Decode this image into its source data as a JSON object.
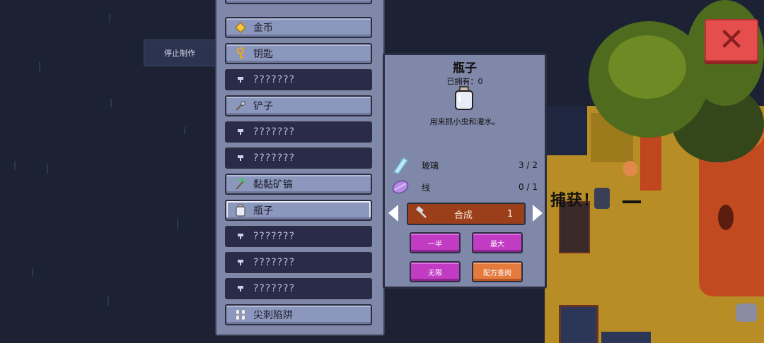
{
  "stop_button": {
    "label": "停止制作"
  },
  "recipe_list": [
    {
      "label": "金币",
      "state": "known",
      "icon": "gold-coin-icon"
    },
    {
      "label": "钥匙",
      "state": "known",
      "icon": "key-icon"
    },
    {
      "label": "???????",
      "state": "unknown",
      "icon": "locked-icon"
    },
    {
      "label": "铲子",
      "state": "known",
      "icon": "shovel-icon"
    },
    {
      "label": "???????",
      "state": "unknown",
      "icon": "locked-icon"
    },
    {
      "label": "???????",
      "state": "unknown",
      "icon": "locked-icon"
    },
    {
      "label": "黏黏矿镐",
      "state": "known",
      "icon": "pickaxe-icon"
    },
    {
      "label": "瓶子",
      "state": "selected",
      "icon": "bottle-icon"
    },
    {
      "label": "???????",
      "state": "unknown",
      "icon": "locked-icon"
    },
    {
      "label": "???????",
      "state": "unknown",
      "icon": "locked-icon"
    },
    {
      "label": "???????",
      "state": "unknown",
      "icon": "locked-icon"
    },
    {
      "label": "尖刺陷阱",
      "state": "known",
      "icon": "spike-trap-icon"
    }
  ],
  "detail": {
    "title": "瓶子",
    "owned": "已拥有：0",
    "description": "用来抓小虫和灌水。",
    "ingredients": [
      {
        "name": "玻璃",
        "count": "3 / 2",
        "icon": "glass-shard-icon"
      },
      {
        "name": "线",
        "count": "0 / 1",
        "icon": "thread-icon"
      }
    ],
    "craft": {
      "label": "合成",
      "quantity": "1"
    },
    "buttons": {
      "half": "一半",
      "max": "最大",
      "infinite": "无限",
      "recipe_book": "配方查阅"
    }
  },
  "world": {
    "catch_text": "捕获！"
  },
  "close_button": {
    "symbol": "✕"
  },
  "colors": {
    "panel": "#7f88a8",
    "known_item": "#8c97bd",
    "unknown_item": "#2a2b48",
    "craft_bar": "#9b3f1a",
    "magenta_button": "#c13cc2",
    "orange_button": "#e57a3d",
    "close_button": "#e64d4d"
  }
}
